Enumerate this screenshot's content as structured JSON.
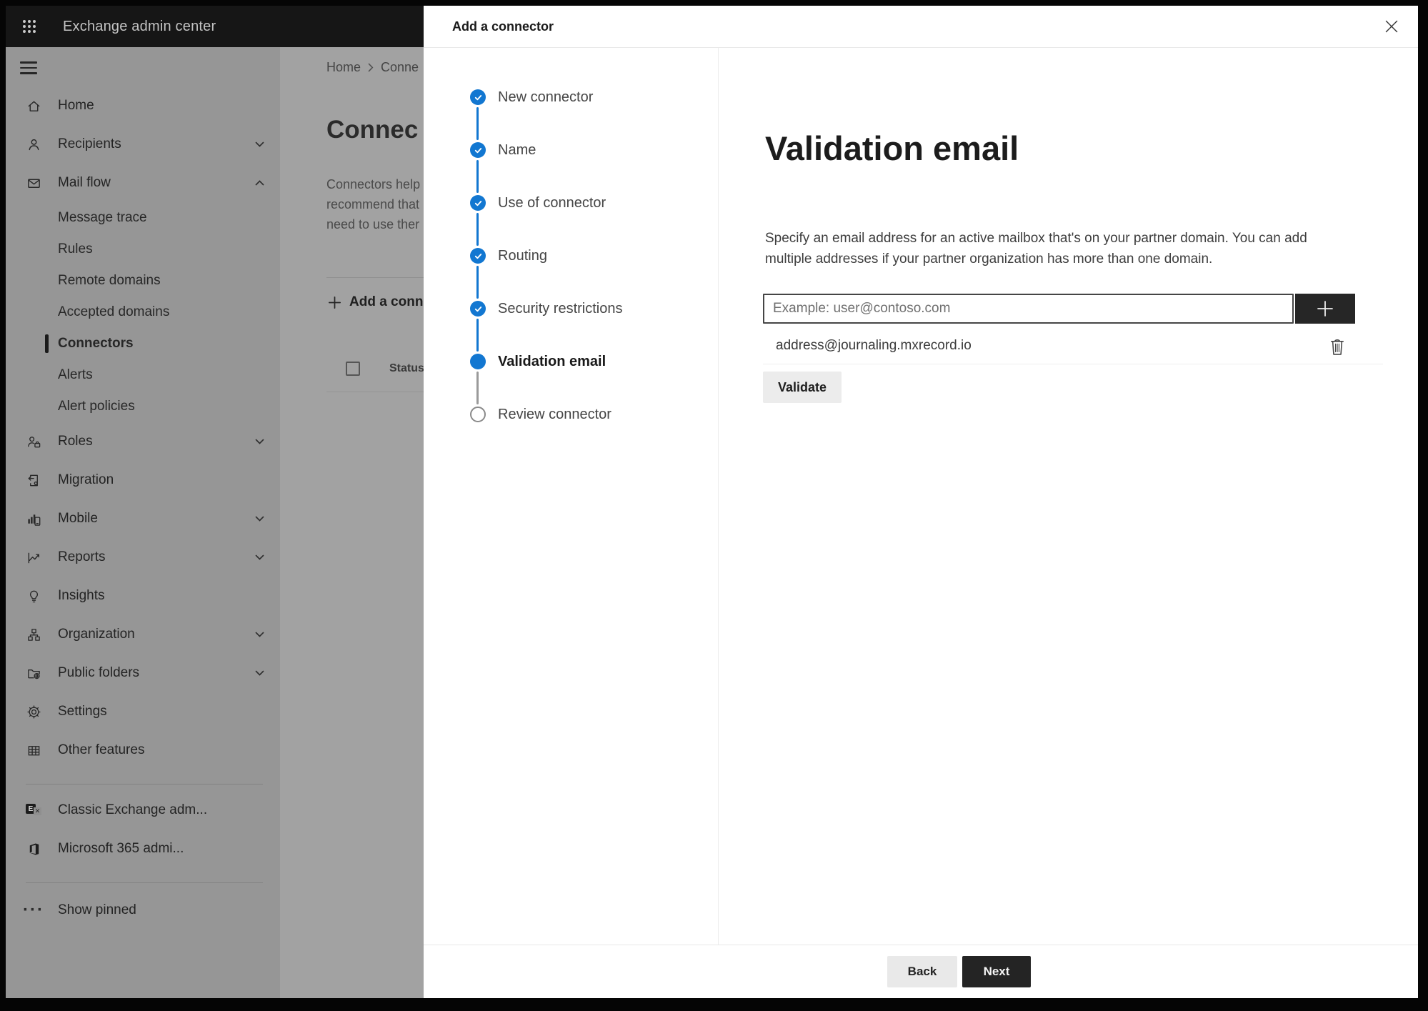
{
  "colors": {
    "accent_blue": "#1277d1",
    "topbar_bg": "#161616",
    "sidebar_bg_dimmed": "#969696",
    "page_bg_dimmed": "#a2a2a2",
    "modal_bg": "#ffffff",
    "primary_button_bg": "#242424"
  },
  "topbar": {
    "app_title": "Exchange admin center"
  },
  "sidebar": {
    "items": [
      {
        "label": "Home"
      },
      {
        "label": "Recipients"
      },
      {
        "label": "Mail flow"
      },
      {
        "label": "Message trace"
      },
      {
        "label": "Rules"
      },
      {
        "label": "Remote domains"
      },
      {
        "label": "Accepted domains"
      },
      {
        "label": "Connectors"
      },
      {
        "label": "Alerts"
      },
      {
        "label": "Alert policies"
      },
      {
        "label": "Roles"
      },
      {
        "label": "Migration"
      },
      {
        "label": "Mobile"
      },
      {
        "label": "Reports"
      },
      {
        "label": "Insights"
      },
      {
        "label": "Organization"
      },
      {
        "label": "Public folders"
      },
      {
        "label": "Settings"
      },
      {
        "label": "Other features"
      },
      {
        "label": "Classic Exchange adm..."
      },
      {
        "label": "Microsoft 365 admi..."
      },
      {
        "label": "Show pinned"
      }
    ]
  },
  "page": {
    "breadcrumb": {
      "home": "Home",
      "current": "Conne"
    },
    "heading": "Connec",
    "intro_lines": [
      "Connectors help",
      "recommend that",
      "need to use ther"
    ],
    "add_button": "Add a conn",
    "status_column": "Status"
  },
  "modal": {
    "title": "Add a connector",
    "steps": [
      {
        "label": "New connector",
        "state": "done"
      },
      {
        "label": "Name",
        "state": "done"
      },
      {
        "label": "Use of connector",
        "state": "done"
      },
      {
        "label": "Routing",
        "state": "done"
      },
      {
        "label": "Security restrictions",
        "state": "done"
      },
      {
        "label": "Validation email",
        "state": "current"
      },
      {
        "label": "Review connector",
        "state": "upcoming"
      }
    ],
    "content": {
      "heading": "Validation email",
      "description": "Specify an email address for an active mailbox that's on your partner domain. You can add multiple addresses if your partner organization has more than one domain.",
      "input_placeholder": "Example: user@contoso.com",
      "addresses": [
        "address@journaling.mxrecord.io"
      ],
      "validate_label": "Validate"
    },
    "footer": {
      "back_label": "Back",
      "next_label": "Next"
    }
  }
}
